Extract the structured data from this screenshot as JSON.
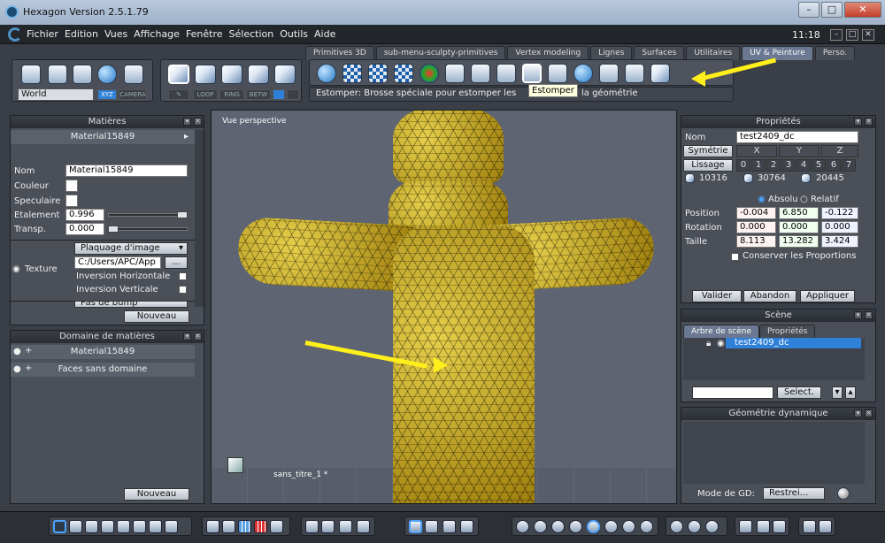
{
  "window": {
    "title": "Hexagon Version 2.5.1.79",
    "minimize": "–",
    "maximize": "□",
    "close": "✕"
  },
  "menubar": {
    "items": [
      "Fichier",
      "Edition",
      "Vues",
      "Affichage",
      "Fenêtre",
      "Sélection",
      "Outils",
      "Aide"
    ],
    "clock": "11:18"
  },
  "tabs": [
    "Primitives 3D",
    "sub-menu-sculpty-primitives",
    "Vertex modeling",
    "Lignes",
    "Surfaces",
    "Utilitaires",
    "UV & Peinture",
    "Perso."
  ],
  "active_tab": "UV & Peinture",
  "toolbar": {
    "world_select": "World",
    "xyz_label": "XYZ",
    "camera_label": "CAMERA",
    "loop_label": "LOOP",
    "ring_label": "RING",
    "betw_label": "BETW",
    "status_text": "Estomper: Brosse spéciale pour estomper les",
    "status_text_end": "de la géométrie",
    "tooltip": "Estomper"
  },
  "materials_panel": {
    "title": "Matières",
    "material_name": "Material15849",
    "nom_label": "Nom",
    "nom_value": "Material15849",
    "couleur_label": "Couleur",
    "speculaire_label": "Speculaire",
    "etalement_label": "Etalement",
    "etalement_value": "0.996",
    "etalement_level": 0.996,
    "transp_label": "Transp.",
    "transp_value": "0.000",
    "transp_level": 0.0,
    "texture_label": "Texture",
    "plaquage": "Plaquage d'image",
    "path": "C:/Users/APC/App",
    "browse": "...",
    "inv_h": "Inversion Horizontale",
    "inv_v": "Inversion Verticale",
    "bump": "Pas de bump",
    "nouveau": "Nouveau"
  },
  "domain_panel": {
    "title": "Domaine de matières",
    "items": [
      "Material15849",
      "Faces sans domaine"
    ],
    "nouveau": "Nouveau"
  },
  "viewport": {
    "label": "Vue perspective",
    "scene_name": "sans_titre_1 *"
  },
  "properties_panel": {
    "title": "Propriétés",
    "nom_label": "Nom",
    "nom_value": "test2409_dc",
    "symetrie": "Symétrie",
    "axes": [
      "X",
      "Y",
      "Z"
    ],
    "lissage": "Lissage",
    "levels": [
      "0",
      "1",
      "2",
      "3",
      "4",
      "5",
      "6",
      "7"
    ],
    "counts": [
      "10316",
      "30764",
      "20445"
    ],
    "absolu": "Absolu",
    "relatif": "Relatif",
    "position_label": "Position",
    "position": [
      "-0.004",
      "6.850",
      "-0.122"
    ],
    "rotation_label": "Rotation",
    "rotation": [
      "0.000",
      "0.000",
      "0.000"
    ],
    "taille_label": "Taille",
    "taille": [
      "8.113",
      "13.282",
      "3.424"
    ],
    "conserver": "Conserver les Proportions",
    "valider": "Valider",
    "abandon": "Abandon",
    "appliquer": "Appliquer"
  },
  "scene_panel": {
    "title": "Scène",
    "tabs": [
      "Arbre de scène",
      "Propriétés"
    ],
    "object": "test2409_dc",
    "select_btn": "Select."
  },
  "dyn_geo_panel": {
    "title": "Géométrie dynamique",
    "mode_label": "Mode de GD:",
    "mode_value": "Restrei..."
  },
  "colors": {
    "accent": "#2e80d8",
    "arrow": "#ffef1a",
    "mesh": "#b79a16"
  }
}
